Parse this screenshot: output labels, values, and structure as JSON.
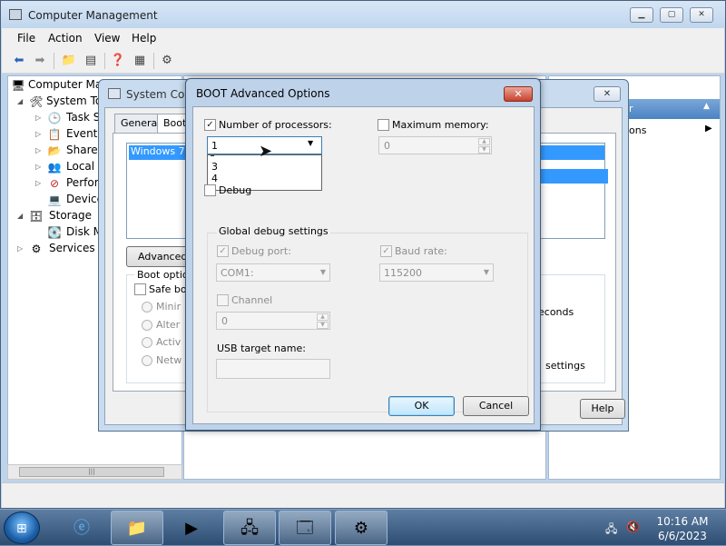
{
  "computer_management": {
    "title": "Computer Management",
    "menu": [
      "File",
      "Action",
      "View",
      "Help"
    ],
    "tree": {
      "root": "Computer Mar",
      "system_tools": "System To",
      "task_scheduler": "Task Sc",
      "event_viewer": "Event V",
      "shared_folders": "Shared",
      "local_users": "Local U",
      "performance": "Perforn",
      "device_manager": "Device",
      "storage": "Storage",
      "disk_management": "Disk M",
      "services": "Services ar"
    },
    "actions_pane": {
      "header_partial": "r",
      "item_partial": "ons"
    }
  },
  "system_configuration": {
    "title": "System Conf",
    "tabs": [
      "General",
      "Boot"
    ],
    "os_entry": "Windows 7 (C",
    "advanced_button": "Advanced o",
    "boot_options_label": "Boot options",
    "safe_boot_label": "Safe bo",
    "radios": [
      "Minir",
      "Alter",
      "Activ",
      "Netw"
    ],
    "seconds_partial": "econds",
    "settings_partial": "settings",
    "help_button": "Help"
  },
  "boot_advanced_options": {
    "title": "BOOT Advanced Options",
    "close_label": "✕",
    "number_of_processors_label": "Number of processors:",
    "number_of_processors_checked": true,
    "number_of_processors_value": "1",
    "number_of_processors_options_visible": [
      "3",
      "4"
    ],
    "maximum_memory_label": "Maximum memory:",
    "maximum_memory_checked": false,
    "maximum_memory_value": "0",
    "debug_label": "Debug",
    "debug_checked": false,
    "global_debug_settings_label": "Global debug settings",
    "debug_port_label": "Debug port:",
    "debug_port_value": "COM1:",
    "baud_rate_label": "Baud rate:",
    "baud_rate_value": "115200",
    "channel_label": "Channel",
    "channel_value": "0",
    "usb_target_name_label": "USB target name:",
    "usb_target_name_value": "",
    "ok_button": "OK",
    "cancel_button": "Cancel"
  },
  "taskbar": {
    "time": "10:16 AM",
    "date": "6/6/2023",
    "items": [
      "start-orb",
      "internet-explorer-icon",
      "windows-explorer-icon",
      "media-player-icon",
      "network-icon",
      "computer-management-icon",
      "system-configuration-icon"
    ]
  }
}
